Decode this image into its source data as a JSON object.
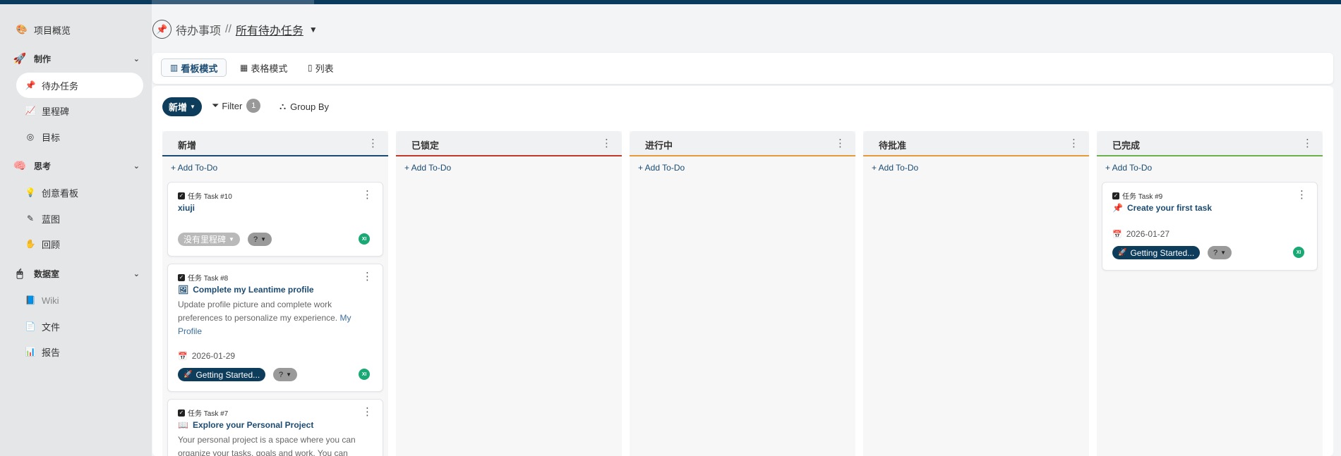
{
  "sidebar": {
    "overview": {
      "label": "项目概览",
      "icon": "palette-icon"
    },
    "groups": {
      "make": {
        "label": "制作",
        "icon": "rocket-icon"
      },
      "think": {
        "label": "思考",
        "icon": "brain-icon"
      },
      "data": {
        "label": "数据室",
        "icon": "mouse-icon"
      }
    },
    "items": {
      "todos": {
        "label": "待办任务",
        "icon": "thumbtack-icon"
      },
      "milestones": {
        "label": "里程碑",
        "icon": "chart-icon"
      },
      "goals": {
        "label": "目标",
        "icon": "target-icon"
      },
      "ideas": {
        "label": "创意看板",
        "icon": "lightbulb-icon"
      },
      "blueprints": {
        "label": "蓝图",
        "icon": "compass-icon"
      },
      "retros": {
        "label": "回顾",
        "icon": "hand-icon"
      },
      "wiki": {
        "label": "Wiki",
        "icon": "book-icon"
      },
      "files": {
        "label": "文件",
        "icon": "file-icon"
      },
      "reports": {
        "label": "报告",
        "icon": "bar-chart-icon"
      }
    }
  },
  "header": {
    "breadcrumb_root": "待办事项",
    "breadcrumb_sep": "//",
    "breadcrumb_current": "所有待办任务"
  },
  "view_tabs": {
    "kanban": "看板模式",
    "table": "表格模式",
    "list": "列表"
  },
  "toolbar": {
    "new_label": "新增",
    "filter_label": "Filter",
    "filter_count": "1",
    "group_by_label": "Group By"
  },
  "add_todo_label": "+ Add To-Do",
  "columns": [
    {
      "title": "新增",
      "color": "#1b4b72"
    },
    {
      "title": "已锁定",
      "color": "#c0392b"
    },
    {
      "title": "进行中",
      "color": "#e69a3a"
    },
    {
      "title": "待批准",
      "color": "#e69a3a"
    },
    {
      "title": "已完成",
      "color": "#6ab04c"
    }
  ],
  "cards": {
    "task10": {
      "meta": "任务 Task #10",
      "title": "xiuji",
      "milestone": "没有里程碑",
      "priority": "?",
      "avatar": "XI"
    },
    "task8": {
      "meta": "任务 Task #8",
      "title": "Complete my Leantime profile",
      "desc": "Update profile picture and complete work preferences to personalize my experience.",
      "desc_link": "My Profile",
      "date": "2026-01-29",
      "milestone": "Getting Started...",
      "priority": "?",
      "avatar": "XI"
    },
    "task7": {
      "meta": "任务 Task #7",
      "title": "Explore your Personal Project",
      "desc": "Your personal project is a space where you can organize your tasks, goals and work. You can"
    },
    "task9": {
      "meta": "任务 Task #9",
      "title": "Create your first task",
      "date": "2026-01-27",
      "milestone": "Getting Started...",
      "priority": "?",
      "avatar": "XI"
    }
  }
}
